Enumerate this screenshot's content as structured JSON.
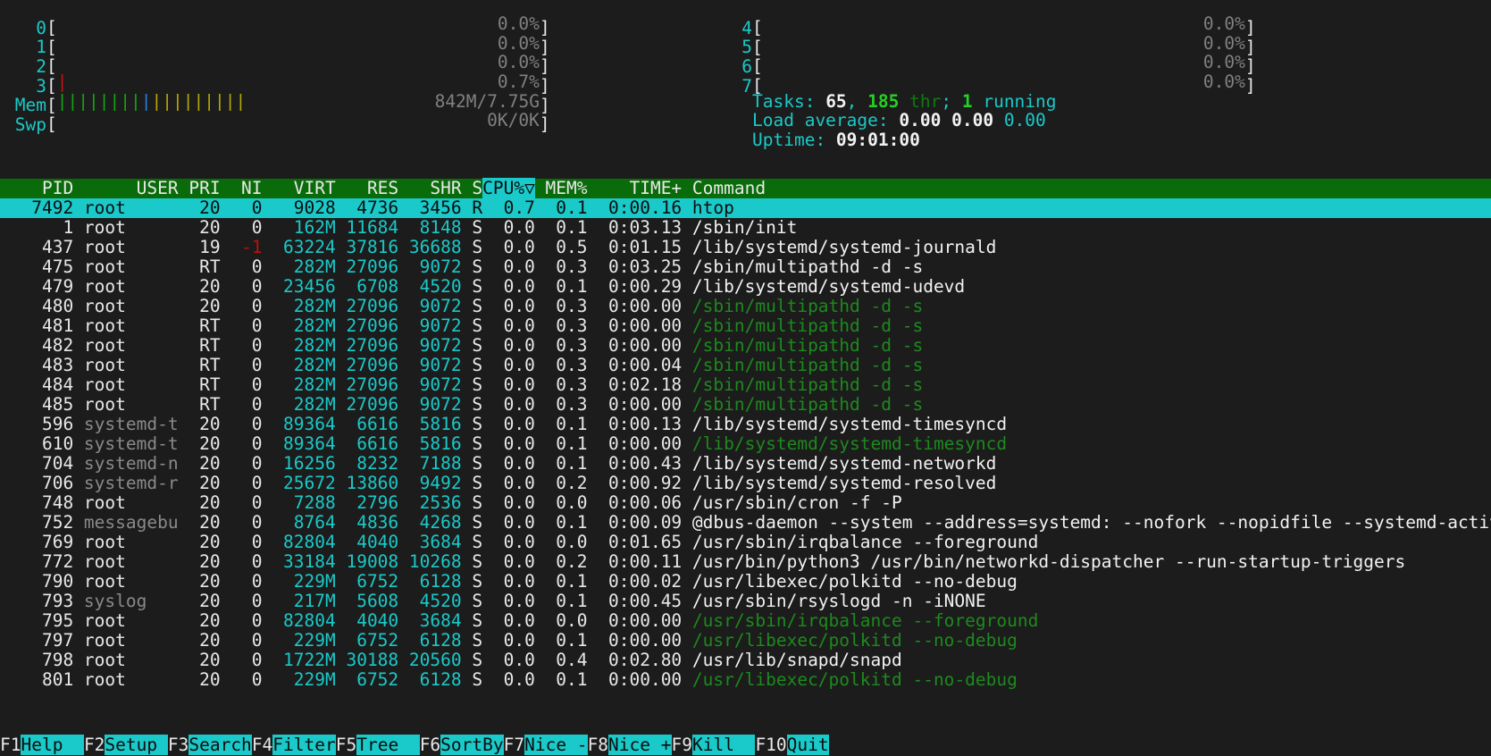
{
  "app": {
    "name": "htop"
  },
  "meters": {
    "cpus_left": [
      {
        "label": "0",
        "pct": "0.0%",
        "bars": []
      },
      {
        "label": "1",
        "pct": "0.0%",
        "bars": []
      },
      {
        "label": "2",
        "pct": "0.0%",
        "bars": []
      },
      {
        "label": "3",
        "pct": "0.7%",
        "bars": [
          {
            "color": "red",
            "n": 1
          }
        ]
      }
    ],
    "cpus_right": [
      {
        "label": "4",
        "pct": "0.0%",
        "bars": []
      },
      {
        "label": "5",
        "pct": "0.0%",
        "bars": []
      },
      {
        "label": "6",
        "pct": "0.0%",
        "bars": []
      },
      {
        "label": "7",
        "pct": "0.0%",
        "bars": []
      }
    ],
    "mem": {
      "label": "Mem",
      "text": "842M/7.75G",
      "bars": [
        {
          "color": "green",
          "n": 8
        },
        {
          "color": "blue",
          "n": 1
        },
        {
          "color": "olive",
          "n": 9
        }
      ]
    },
    "swap": {
      "label": "Swp",
      "text": "0K/0K",
      "bars": []
    }
  },
  "summary": {
    "tasks_label": "Tasks: ",
    "tasks_count": "65",
    "tasks_sep": ", ",
    "threads_count": "185",
    "threads_label": " thr",
    "threads_sep": "; ",
    "running_count": "1",
    "running_label": " running",
    "load_label": "Load average: ",
    "load1": "0.00",
    "load5": "0.00",
    "load15": "0.00",
    "uptime_label": "Uptime: ",
    "uptime_value": "09:01:00"
  },
  "table": {
    "columns": [
      {
        "key": "pid",
        "label": "PID",
        "width": 7,
        "align": "right"
      },
      {
        "key": "user",
        "label": "USER",
        "width": 10,
        "align": "left"
      },
      {
        "key": "pri",
        "label": "PRI",
        "width": 4,
        "align": "right"
      },
      {
        "key": "ni",
        "label": "NI",
        "width": 4,
        "align": "right"
      },
      {
        "key": "virt",
        "label": "VIRT",
        "width": 7,
        "align": "right"
      },
      {
        "key": "res",
        "label": "RES",
        "width": 6,
        "align": "right"
      },
      {
        "key": "shr",
        "label": "SHR",
        "width": 6,
        "align": "right"
      },
      {
        "key": "s",
        "label": "S",
        "width": 2,
        "align": "right"
      },
      {
        "key": "cpu",
        "label": "CPU%",
        "width": 5,
        "align": "right",
        "sorted": true,
        "sort_glyph": "▽"
      },
      {
        "key": "mem",
        "label": "MEM%",
        "width": 5,
        "align": "right"
      },
      {
        "key": "time",
        "label": "TIME+",
        "width": 9,
        "align": "right"
      },
      {
        "key": "command",
        "label": "Command",
        "width": 0,
        "align": "left"
      }
    ],
    "rows": [
      {
        "pid": "7492",
        "user": "root",
        "pri": "20",
        "ni": "0",
        "virt": "9028",
        "res": "4736",
        "shr": "3456",
        "s": "R",
        "cpu": "0.7",
        "mem": "0.1",
        "time": "0:00.16",
        "command": "htop",
        "selected": true,
        "thread": false,
        "user_dim": false
      },
      {
        "pid": "1",
        "user": "root",
        "pri": "20",
        "ni": "0",
        "virt": "162M",
        "res": "11684",
        "shr": "8148",
        "s": "S",
        "cpu": "0.0",
        "mem": "0.1",
        "time": "0:03.13",
        "command": "/sbin/init",
        "selected": false,
        "thread": false,
        "user_dim": false
      },
      {
        "pid": "437",
        "user": "root",
        "pri": "19",
        "ni": "-1",
        "virt": "63224",
        "res": "37816",
        "shr": "36688",
        "s": "S",
        "cpu": "0.0",
        "mem": "0.5",
        "time": "0:01.15",
        "command": "/lib/systemd/systemd-journald",
        "selected": false,
        "thread": false,
        "user_dim": false
      },
      {
        "pid": "475",
        "user": "root",
        "pri": "RT",
        "ni": "0",
        "virt": "282M",
        "res": "27096",
        "shr": "9072",
        "s": "S",
        "cpu": "0.0",
        "mem": "0.3",
        "time": "0:03.25",
        "command": "/sbin/multipathd -d -s",
        "selected": false,
        "thread": false,
        "user_dim": false
      },
      {
        "pid": "479",
        "user": "root",
        "pri": "20",
        "ni": "0",
        "virt": "23456",
        "res": "6708",
        "shr": "4520",
        "s": "S",
        "cpu": "0.0",
        "mem": "0.1",
        "time": "0:00.29",
        "command": "/lib/systemd/systemd-udevd",
        "selected": false,
        "thread": false,
        "user_dim": false
      },
      {
        "pid": "480",
        "user": "root",
        "pri": "20",
        "ni": "0",
        "virt": "282M",
        "res": "27096",
        "shr": "9072",
        "s": "S",
        "cpu": "0.0",
        "mem": "0.3",
        "time": "0:00.00",
        "command": "/sbin/multipathd -d -s",
        "selected": false,
        "thread": true,
        "user_dim": false
      },
      {
        "pid": "481",
        "user": "root",
        "pri": "RT",
        "ni": "0",
        "virt": "282M",
        "res": "27096",
        "shr": "9072",
        "s": "S",
        "cpu": "0.0",
        "mem": "0.3",
        "time": "0:00.00",
        "command": "/sbin/multipathd -d -s",
        "selected": false,
        "thread": true,
        "user_dim": false
      },
      {
        "pid": "482",
        "user": "root",
        "pri": "RT",
        "ni": "0",
        "virt": "282M",
        "res": "27096",
        "shr": "9072",
        "s": "S",
        "cpu": "0.0",
        "mem": "0.3",
        "time": "0:00.00",
        "command": "/sbin/multipathd -d -s",
        "selected": false,
        "thread": true,
        "user_dim": false
      },
      {
        "pid": "483",
        "user": "root",
        "pri": "RT",
        "ni": "0",
        "virt": "282M",
        "res": "27096",
        "shr": "9072",
        "s": "S",
        "cpu": "0.0",
        "mem": "0.3",
        "time": "0:00.04",
        "command": "/sbin/multipathd -d -s",
        "selected": false,
        "thread": true,
        "user_dim": false
      },
      {
        "pid": "484",
        "user": "root",
        "pri": "RT",
        "ni": "0",
        "virt": "282M",
        "res": "27096",
        "shr": "9072",
        "s": "S",
        "cpu": "0.0",
        "mem": "0.3",
        "time": "0:02.18",
        "command": "/sbin/multipathd -d -s",
        "selected": false,
        "thread": true,
        "user_dim": false
      },
      {
        "pid": "485",
        "user": "root",
        "pri": "RT",
        "ni": "0",
        "virt": "282M",
        "res": "27096",
        "shr": "9072",
        "s": "S",
        "cpu": "0.0",
        "mem": "0.3",
        "time": "0:00.00",
        "command": "/sbin/multipathd -d -s",
        "selected": false,
        "thread": true,
        "user_dim": false
      },
      {
        "pid": "596",
        "user": "systemd-t",
        "pri": "20",
        "ni": "0",
        "virt": "89364",
        "res": "6616",
        "shr": "5816",
        "s": "S",
        "cpu": "0.0",
        "mem": "0.1",
        "time": "0:00.13",
        "command": "/lib/systemd/systemd-timesyncd",
        "selected": false,
        "thread": false,
        "user_dim": true
      },
      {
        "pid": "610",
        "user": "systemd-t",
        "pri": "20",
        "ni": "0",
        "virt": "89364",
        "res": "6616",
        "shr": "5816",
        "s": "S",
        "cpu": "0.0",
        "mem": "0.1",
        "time": "0:00.00",
        "command": "/lib/systemd/systemd-timesyncd",
        "selected": false,
        "thread": true,
        "user_dim": true
      },
      {
        "pid": "704",
        "user": "systemd-n",
        "pri": "20",
        "ni": "0",
        "virt": "16256",
        "res": "8232",
        "shr": "7188",
        "s": "S",
        "cpu": "0.0",
        "mem": "0.1",
        "time": "0:00.43",
        "command": "/lib/systemd/systemd-networkd",
        "selected": false,
        "thread": false,
        "user_dim": true
      },
      {
        "pid": "706",
        "user": "systemd-r",
        "pri": "20",
        "ni": "0",
        "virt": "25672",
        "res": "13860",
        "shr": "9492",
        "s": "S",
        "cpu": "0.0",
        "mem": "0.2",
        "time": "0:00.92",
        "command": "/lib/systemd/systemd-resolved",
        "selected": false,
        "thread": false,
        "user_dim": true
      },
      {
        "pid": "748",
        "user": "root",
        "pri": "20",
        "ni": "0",
        "virt": "7288",
        "res": "2796",
        "shr": "2536",
        "s": "S",
        "cpu": "0.0",
        "mem": "0.0",
        "time": "0:00.06",
        "command": "/usr/sbin/cron -f -P",
        "selected": false,
        "thread": false,
        "user_dim": false
      },
      {
        "pid": "752",
        "user": "messagebu",
        "pri": "20",
        "ni": "0",
        "virt": "8764",
        "res": "4836",
        "shr": "4268",
        "s": "S",
        "cpu": "0.0",
        "mem": "0.1",
        "time": "0:00.09",
        "command": "@dbus-daemon --system --address=systemd: --nofork --nopidfile --systemd-activation --",
        "selected": false,
        "thread": false,
        "user_dim": true
      },
      {
        "pid": "769",
        "user": "root",
        "pri": "20",
        "ni": "0",
        "virt": "82804",
        "res": "4040",
        "shr": "3684",
        "s": "S",
        "cpu": "0.0",
        "mem": "0.0",
        "time": "0:01.65",
        "command": "/usr/sbin/irqbalance --foreground",
        "selected": false,
        "thread": false,
        "user_dim": false
      },
      {
        "pid": "772",
        "user": "root",
        "pri": "20",
        "ni": "0",
        "virt": "33184",
        "res": "19008",
        "shr": "10268",
        "s": "S",
        "cpu": "0.0",
        "mem": "0.2",
        "time": "0:00.11",
        "command": "/usr/bin/python3 /usr/bin/networkd-dispatcher --run-startup-triggers",
        "selected": false,
        "thread": false,
        "user_dim": false
      },
      {
        "pid": "790",
        "user": "root",
        "pri": "20",
        "ni": "0",
        "virt": "229M",
        "res": "6752",
        "shr": "6128",
        "s": "S",
        "cpu": "0.0",
        "mem": "0.1",
        "time": "0:00.02",
        "command": "/usr/libexec/polkitd --no-debug",
        "selected": false,
        "thread": false,
        "user_dim": false
      },
      {
        "pid": "793",
        "user": "syslog",
        "pri": "20",
        "ni": "0",
        "virt": "217M",
        "res": "5608",
        "shr": "4520",
        "s": "S",
        "cpu": "0.0",
        "mem": "0.1",
        "time": "0:00.45",
        "command": "/usr/sbin/rsyslogd -n -iNONE",
        "selected": false,
        "thread": false,
        "user_dim": true
      },
      {
        "pid": "795",
        "user": "root",
        "pri": "20",
        "ni": "0",
        "virt": "82804",
        "res": "4040",
        "shr": "3684",
        "s": "S",
        "cpu": "0.0",
        "mem": "0.0",
        "time": "0:00.00",
        "command": "/usr/sbin/irqbalance --foreground",
        "selected": false,
        "thread": true,
        "user_dim": false
      },
      {
        "pid": "797",
        "user": "root",
        "pri": "20",
        "ni": "0",
        "virt": "229M",
        "res": "6752",
        "shr": "6128",
        "s": "S",
        "cpu": "0.0",
        "mem": "0.1",
        "time": "0:00.00",
        "command": "/usr/libexec/polkitd --no-debug",
        "selected": false,
        "thread": true,
        "user_dim": false
      },
      {
        "pid": "798",
        "user": "root",
        "pri": "20",
        "ni": "0",
        "virt": "1722M",
        "res": "30188",
        "shr": "20560",
        "s": "S",
        "cpu": "0.0",
        "mem": "0.4",
        "time": "0:02.80",
        "command": "/usr/lib/snapd/snapd",
        "selected": false,
        "thread": false,
        "user_dim": false
      },
      {
        "pid": "801",
        "user": "root",
        "pri": "20",
        "ni": "0",
        "virt": "229M",
        "res": "6752",
        "shr": "6128",
        "s": "S",
        "cpu": "0.0",
        "mem": "0.1",
        "time": "0:00.00",
        "command": "/usr/libexec/polkitd --no-debug",
        "selected": false,
        "thread": true,
        "user_dim": false
      }
    ]
  },
  "function_bar": [
    {
      "key": "F1",
      "label": "Help  "
    },
    {
      "key": "F2",
      "label": "Setup "
    },
    {
      "key": "F3",
      "label": "Search"
    },
    {
      "key": "F4",
      "label": "Filter"
    },
    {
      "key": "F5",
      "label": "Tree  "
    },
    {
      "key": "F6",
      "label": "SortBy"
    },
    {
      "key": "F7",
      "label": "Nice -"
    },
    {
      "key": "F8",
      "label": "Nice +"
    },
    {
      "key": "F9",
      "label": "Kill  "
    },
    {
      "key": "F10",
      "label": "Quit"
    }
  ],
  "colors": {
    "background": "#1c1c1c",
    "accent_cyan": "#1ac9c9",
    "header_green": "#0a6b0a",
    "bar_green": "#11a611",
    "bar_blue": "#2a7fdd",
    "bar_olive": "#b7a800",
    "bar_red": "#c41414",
    "thread_green": "#1d8a1d",
    "dim_gray": "#808080"
  }
}
